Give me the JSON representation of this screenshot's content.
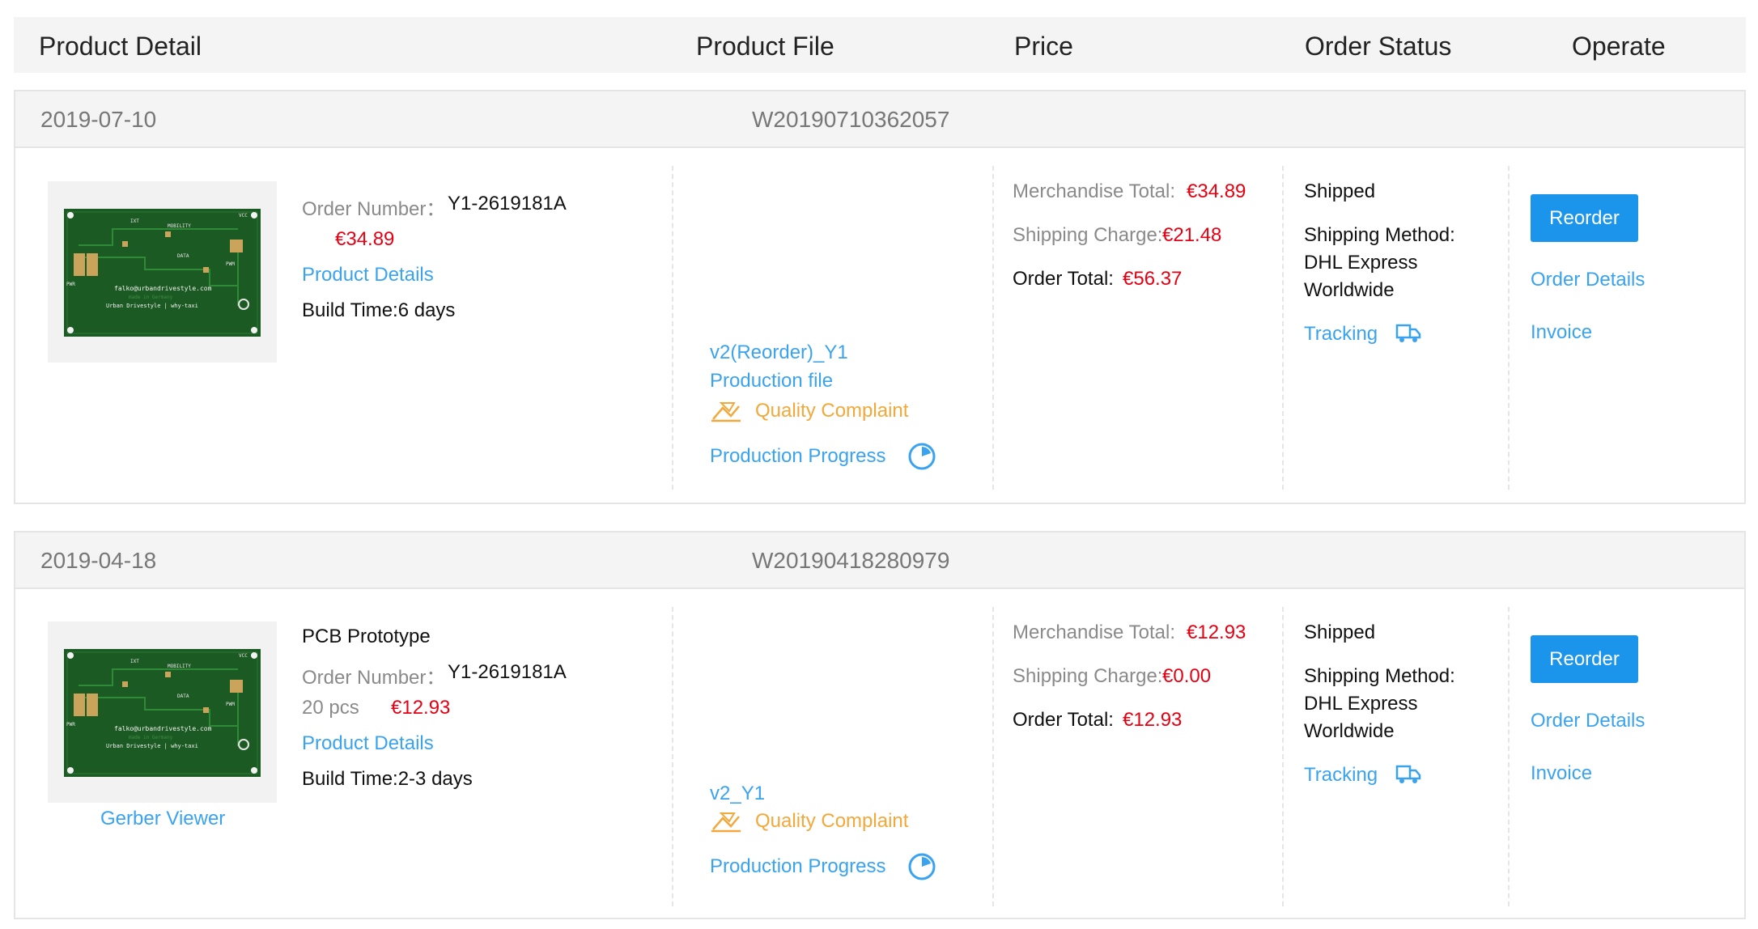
{
  "header": {
    "product_detail": "Product Detail",
    "product_file": "Product File",
    "price": "Price",
    "order_status": "Order Status",
    "operate": "Operate"
  },
  "orders": [
    {
      "date": "2019-07-10",
      "order_no": "W20190710362057",
      "product_name": "",
      "order_number_label": "Order Number：",
      "order_number": "Y1-2619181A",
      "qty": "",
      "unit_price": "€34.89",
      "product_details": "Product Details",
      "build_time": "Build Time:6 days",
      "gerber_viewer": "",
      "file_name": "v2(Reorder)_Y1",
      "production_file": "Production file",
      "quality_complaint": "Quality Complaint",
      "production_progress": "Production Progress",
      "merch_label": "Merchandise Total:",
      "merch_value": "€34.89",
      "ship_label": "Shipping Charge:",
      "ship_value": "€21.48",
      "total_label": "Order Total:",
      "total_value": "€56.37",
      "status": "Shipped",
      "ship_method_label": "Shipping Method:",
      "ship_method_1": "DHL Express",
      "ship_method_2": "Worldwide",
      "tracking": "Tracking",
      "reorder": "Reorder",
      "order_details": "Order Details",
      "invoice": "Invoice"
    },
    {
      "date": "2019-04-18",
      "order_no": "W20190418280979",
      "product_name": "PCB Prototype",
      "order_number_label": "Order Number：",
      "order_number": "Y1-2619181A",
      "qty": "20 pcs",
      "unit_price": "€12.93",
      "product_details": "Product Details",
      "build_time": "Build Time:2-3 days",
      "gerber_viewer": "Gerber Viewer",
      "file_name": "v2_Y1",
      "production_file": "",
      "quality_complaint": "Quality Complaint",
      "production_progress": "Production Progress",
      "merch_label": "Merchandise Total:",
      "merch_value": "€12.93",
      "ship_label": "Shipping Charge:",
      "ship_value": "€0.00",
      "total_label": "Order Total:",
      "total_value": "€12.93",
      "status": "Shipped",
      "ship_method_label": "Shipping Method:",
      "ship_method_1": "DHL Express",
      "ship_method_2": "Worldwide",
      "tracking": "Tracking",
      "reorder": "Reorder",
      "order_details": "Order Details",
      "invoice": "Invoice"
    }
  ],
  "pcb_silkscreen": {
    "email": "falko@urbandrivestyle.com",
    "line2": "Urban Drivestyle | why-taxi",
    "line3": "made in Germany",
    "labels": [
      "IXT",
      "MOBILITY",
      "DATA",
      "VCC",
      "PWR",
      "PWM"
    ]
  },
  "icons": {
    "quality": "quality-complaint-icon",
    "progress": "progress-circle-icon",
    "tracking": "truck-icon"
  },
  "colors": {
    "link_blue": "#3aa3f0",
    "price_red": "#e60012",
    "warning_orange": "#f2a83a",
    "button_blue": "#1b94ec",
    "pcb_green": "#1c5a23"
  }
}
